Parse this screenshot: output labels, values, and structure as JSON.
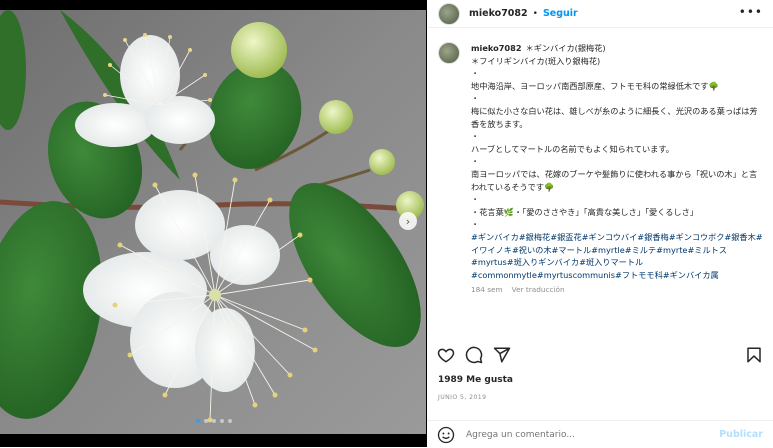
{
  "post": {
    "image_alt": "White myrtle flowers with green leaves",
    "carousel": {
      "count": 5,
      "active": 0
    }
  },
  "header": {
    "username": "mieko7082",
    "separator": "•",
    "follow_label": "Seguir",
    "more_label": "•••"
  },
  "caption": {
    "username": "mieko7082",
    "lines": [
      "＊ギンバイカ(銀梅花)",
      "＊フイリギンバイカ(斑入り銀梅花)",
      "・",
      "地中海沿岸、ヨーロッパ南西部原産、フトモモ科の常緑低木です🌳",
      "・",
      "梅に似た小さな白い花は、雄しべが糸のように細長く、光沢のある葉っぱは芳香を放ちます。",
      "・",
      "ハーブとしてマートルの名前でもよく知られています。",
      "・",
      "南ヨーロッパでは、花嫁のブーケや髪飾りに使われる事から「祝いの木」と言われているそうです🌳",
      "・",
      "・花言葉🌿・「愛のささやき」「高貴な美しさ」「愛くるしさ」",
      "・"
    ],
    "hashtags": "#ギンバイカ#銀梅花#銀盃花#ギンコウバイ#銀香梅#ギンコウボク#銀香木#イワイノキ#祝いの木#マートル#myrtle#ミルテ#myrte#ミルトス#myrtus#斑入りギンバイカ#斑入りマートル#commonmytle#myrtuscommunis#フトモモ科#ギンバイカ属",
    "time_ago": "184 sem",
    "translate_label": "Ver traducción"
  },
  "likes": "1989 Me gusta",
  "date": "JUNIO 5, 2019",
  "comment": {
    "placeholder": "Agrega un comentario...",
    "publish_label": "Publicar"
  },
  "icons": {
    "like": "heart-icon",
    "comment": "comment-icon",
    "share": "paper-plane-icon",
    "save": "bookmark-icon",
    "emoji": "smiley-icon",
    "next": "chevron-right-icon"
  },
  "colors": {
    "link_blue": "#0095f6",
    "hashtag": "#00376b",
    "muted": "#8e8e8e",
    "publish_disabled": "#b2dffc"
  }
}
